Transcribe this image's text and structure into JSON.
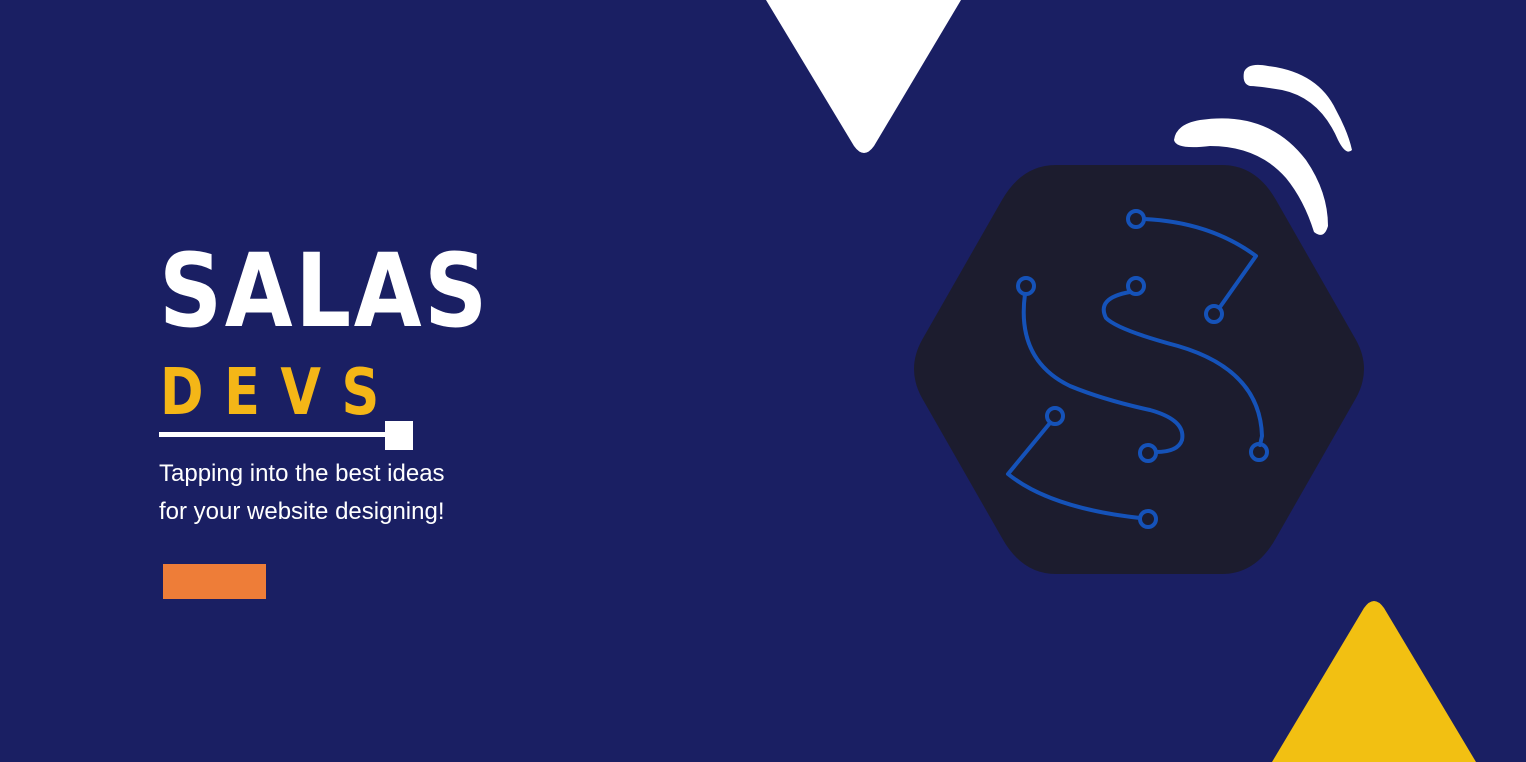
{
  "brand": {
    "title": "SALAS",
    "subtitle": "DEVS"
  },
  "tagline": {
    "line1": "Tapping into the best ideas",
    "line2": "for your website designing!"
  },
  "cta": {
    "label": ""
  },
  "colors": {
    "background": "#1a1f63",
    "accent_yellow": "#f4b617",
    "accent_orange": "#ee7d38",
    "logo_dark": "#1c1c2e",
    "circuit_blue": "#1552b8",
    "white": "#ffffff"
  },
  "icons": {
    "logo": "circuit-s-logo-icon",
    "signal": "signal-arcs-icon",
    "triangle_top": "white-triangle-icon",
    "triangle_bottom": "yellow-triangle-icon"
  }
}
